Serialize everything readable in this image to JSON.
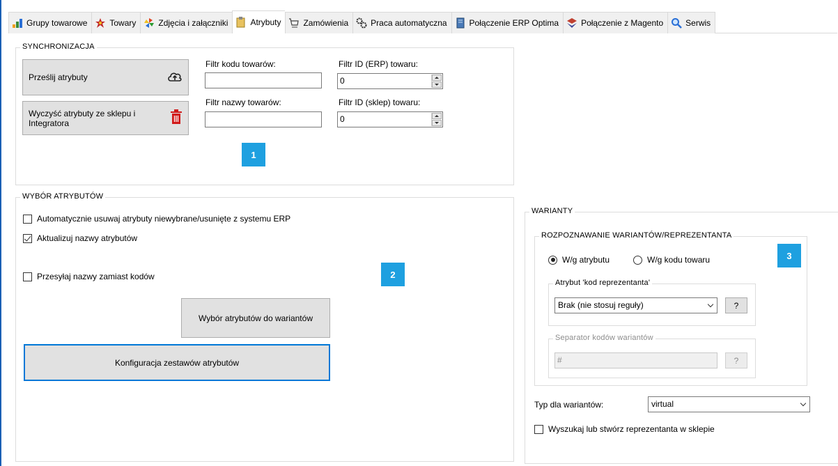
{
  "tabs": [
    {
      "label": "Grupy towarowe",
      "icon": "product-groups-icon"
    },
    {
      "label": "Towary",
      "icon": "products-icon"
    },
    {
      "label": "Zdjęcia i załączniki",
      "icon": "pinwheel-icon"
    },
    {
      "label": "Atrybuty",
      "icon": "attributes-icon"
    },
    {
      "label": "Zamówienia",
      "icon": "cart-icon"
    },
    {
      "label": "Praca automatyczna",
      "icon": "gears-icon"
    },
    {
      "label": "Połączenie ERP Optima",
      "icon": "erp-server-icon"
    },
    {
      "label": "Połączenie z Magento",
      "icon": "magento-icon"
    },
    {
      "label": "Serwis",
      "icon": "magnifier-icon"
    }
  ],
  "sync": {
    "title": "SYNCHRONIZACJA",
    "send_label": "Prześlij atrybuty",
    "clear_label_line1": "Wyczyść atrybuty ze sklepu i",
    "clear_label_line2": "Integratora",
    "filter_code_label": "Filtr kodu towarów:",
    "filter_code_value": "",
    "filter_name_label": "Filtr nazwy towarów:",
    "filter_name_value": "",
    "filter_erp_label": "Filtr ID (ERP) towaru:",
    "filter_erp_value": "0",
    "filter_shop_label": "Filtr ID (sklep) towaru:",
    "filter_shop_value": "0",
    "badge": "1"
  },
  "attributes": {
    "title": "WYBÓR ATRYBUTÓW",
    "auto_remove_label": "Automatycznie usuwaj atrybuty niewybrane/usunięte z systemu ERP",
    "auto_remove_checked": false,
    "update_names_label": "Aktualizuj nazwy atrybutów",
    "update_names_checked": true,
    "send_names_label": "Przesyłaj nazwy zamiast kodów",
    "send_names_checked": false,
    "variants_btn": "Wybór atrybutów do wariantów",
    "sets_btn": "Konfiguracja zestawów atrybutów",
    "badge": "2"
  },
  "variants": {
    "title": "WARIANTY",
    "recognition_title": "ROZPOZNAWANIE WARIANTÓW/REPREZENTANTA",
    "radio_attr": "W/g atrybutu",
    "radio_code": "W/g kodu towaru",
    "selected": "attr",
    "rep_attr_title": "Atrybut 'kod reprezentanta'",
    "rep_attr_value": "Brak (nie stosuj reguły)",
    "help": "?",
    "separator_title": "Separator kodów wariantów",
    "separator_value": "#",
    "type_label": "Typ dla wariantów:",
    "type_value": "virtual",
    "find_create_label": "Wyszukaj lub stwórz reprezentanta w sklepie",
    "find_create_checked": false,
    "badge": "3"
  },
  "colors": {
    "accent": "#1ea0e0",
    "delete_red": "#d11a1a"
  }
}
